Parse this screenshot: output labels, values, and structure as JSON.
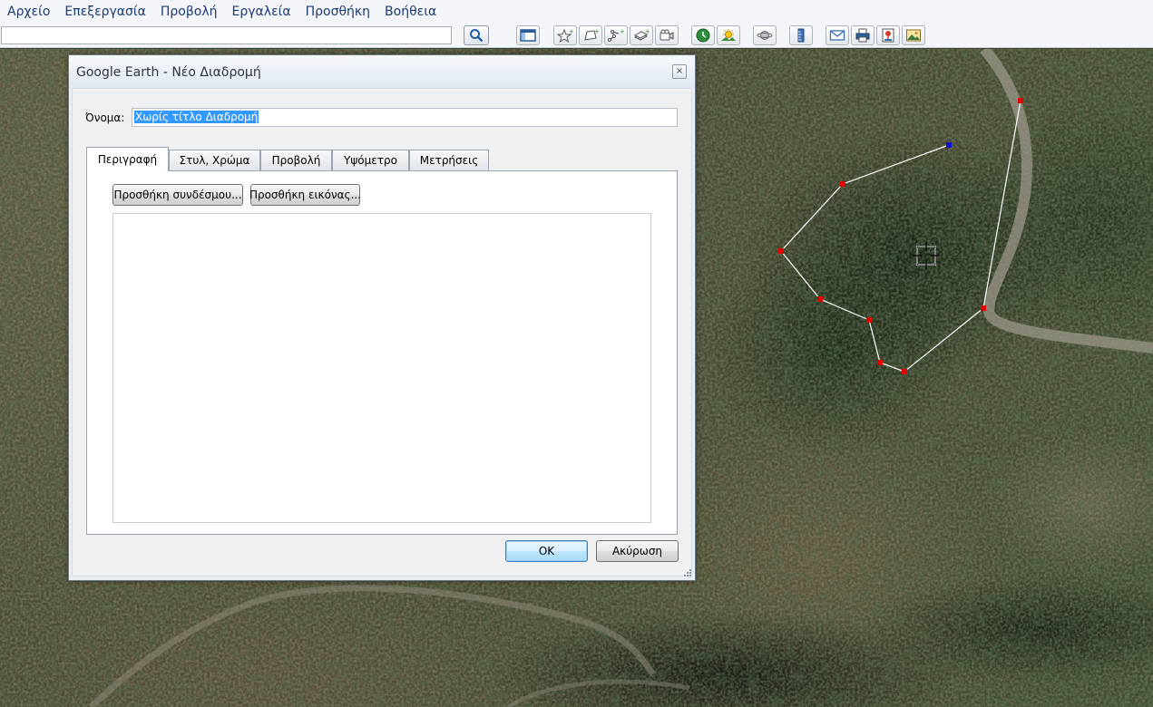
{
  "menu": {
    "items": [
      "Αρχείο",
      "Επεξεργασία",
      "Προβολή",
      "Εργαλεία",
      "Προσθήκη",
      "Βοήθεια"
    ]
  },
  "toolbar": {
    "search_value": "",
    "icons": [
      "search-icon",
      "sidebar-icon",
      "placemark-icon",
      "polygon-icon",
      "path-icon",
      "overlay-icon",
      "tour-icon",
      "historical-imagery-icon",
      "sunlight-icon",
      "planets-icon",
      "ruler-icon",
      "email-icon",
      "print-icon",
      "google-maps-icon",
      "save-image-icon"
    ]
  },
  "dialog": {
    "title": "Google Earth - Νέο Διαδρομή",
    "close_glyph": "×",
    "name_label": "Όνομα:",
    "name_value": "Χωρίς τίτλο Διαδρομή",
    "tabs": [
      "Περιγραφή",
      "Στυλ, Χρώμα",
      "Προβολή",
      "Υψόμετρο",
      "Μετρήσεις"
    ],
    "active_tab": "Περιγραφή",
    "add_link_label": "Προσθήκη συνδέσμου...",
    "add_image_label": "Προσθήκη εικόνας...",
    "description_value": "",
    "ok_label": "OK",
    "cancel_label": "Ακύρωση"
  },
  "map": {
    "path_color": "#ffffff",
    "vertex_color": "#e00000",
    "active_vertex_color": "#1010d0"
  }
}
